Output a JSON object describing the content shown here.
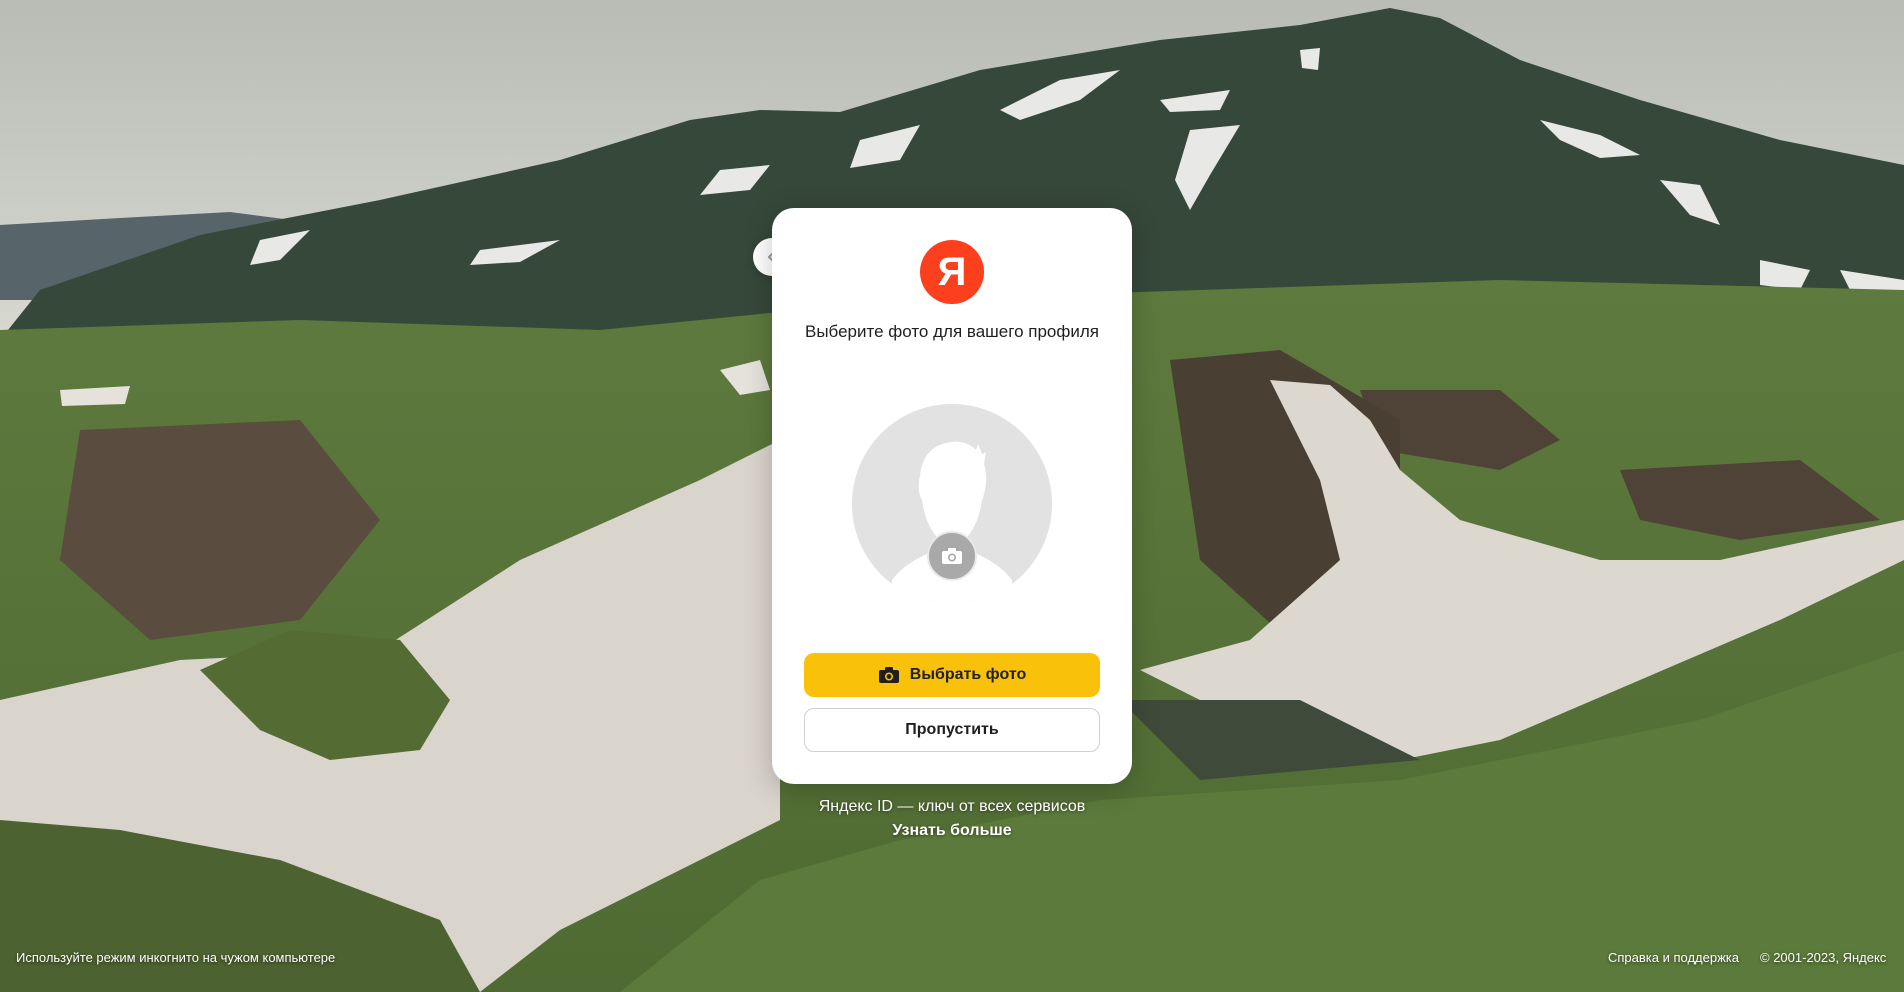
{
  "card": {
    "logo_letter": "Я",
    "title": "Выберите фото для вашего профиля",
    "choose_photo_label": "Выбрать фото",
    "skip_label": "Пропустить"
  },
  "below_card": {
    "tagline": "Яндекс ID — ключ от всех сервисов",
    "learn_more": "Узнать больше"
  },
  "footer": {
    "incognito_hint": "Используйте режим инкогнито на чужом компьютере",
    "help": "Справка и поддержка",
    "copyright": "© 2001-2023, Яндекс"
  },
  "icons": {
    "back": "chevron-left-icon",
    "camera": "camera-icon",
    "avatar": "default-avatar-silhouette-icon"
  },
  "colors": {
    "brand_red": "#fc3f1d",
    "primary_button": "#fac10a"
  }
}
